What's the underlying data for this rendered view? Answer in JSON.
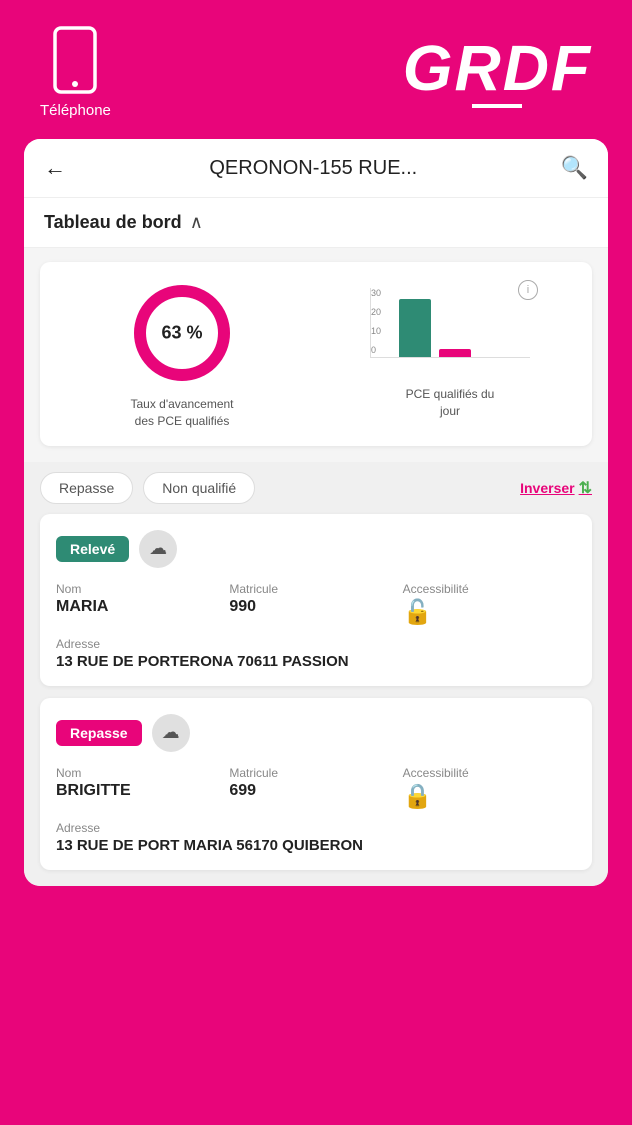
{
  "header": {
    "phone_label": "Téléphone",
    "logo_text": "GRDF"
  },
  "topbar": {
    "title": "QERONON-155 RUE...",
    "back_label": "←",
    "search_label": "🔍"
  },
  "section": {
    "title": "Tableau de bord",
    "chevron": "∧"
  },
  "dashboard": {
    "donut": {
      "percent": "63 %",
      "label_line1": "Taux d'avancement",
      "label_line2": "des PCE qualifiés"
    },
    "bar_chart": {
      "y_labels": [
        "30",
        "20",
        "10",
        "0"
      ],
      "teal_height": 70,
      "pink_height": 10,
      "label_line1": "PCE qualifiés du",
      "label_line2": "jour"
    }
  },
  "filters": {
    "repasse_label": "Repasse",
    "non_qualifie_label": "Non qualifié",
    "inverser_label": "Inverser"
  },
  "items": [
    {
      "badge": "Relevé",
      "badge_type": "releve",
      "nom_label": "Nom",
      "nom_value": "MARIA",
      "matricule_label": "Matricule",
      "matricule_value": "990",
      "accessibilite_label": "Accessibilité",
      "lock_type": "open",
      "adresse_label": "Adresse",
      "adresse_value": "13 RUE DE PORTERONA 70611 PASSION"
    },
    {
      "badge": "Repasse",
      "badge_type": "repasse",
      "nom_label": "Nom",
      "nom_value": "BRIGITTE",
      "matricule_label": "Matricule",
      "matricule_value": "699",
      "accessibilite_label": "Accessibilité",
      "lock_type": "closed",
      "adresse_label": "Adresse",
      "adresse_value": "13 RUE DE PORT MARIA 56170 QUIBERON"
    }
  ]
}
